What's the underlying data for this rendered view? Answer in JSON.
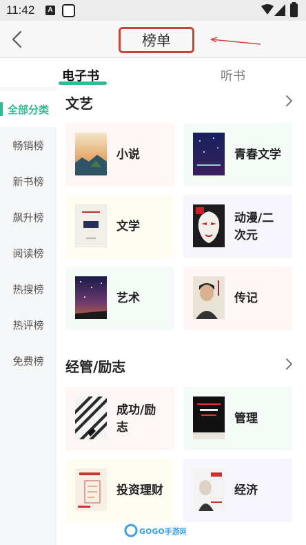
{
  "status_bar": {
    "time": "11:42",
    "notif_letter": "A"
  },
  "header": {
    "title": "榜单"
  },
  "tabs": [
    {
      "label": "电子书"
    },
    {
      "label": "听书"
    }
  ],
  "sidebar": {
    "items": [
      {
        "label": "全部分类"
      },
      {
        "label": "畅销榜"
      },
      {
        "label": "新书榜"
      },
      {
        "label": "飙升榜"
      },
      {
        "label": "阅读榜"
      },
      {
        "label": "热搜榜"
      },
      {
        "label": "热评榜"
      },
      {
        "label": "免费榜"
      }
    ]
  },
  "sections": [
    {
      "title": "文艺",
      "cards": [
        {
          "label": "小说",
          "cover_icon": "book-cover-landscape"
        },
        {
          "label": "青春文学",
          "cover_icon": "book-cover-night-sky"
        },
        {
          "label": "文学",
          "cover_icon": "book-cover-plain"
        },
        {
          "label": "动漫/二次元",
          "label_line1": "动漫/二",
          "label_line2": "次元",
          "cover_icon": "book-cover-mask"
        },
        {
          "label": "艺术",
          "cover_icon": "book-cover-starry-sky"
        },
        {
          "label": "传记",
          "cover_icon": "book-cover-portrait"
        }
      ]
    },
    {
      "title": "经管/励志",
      "cards": [
        {
          "label": "成功/励志",
          "label_line1": "成功/励",
          "label_line2": "志",
          "cover_icon": "book-cover-stripes"
        },
        {
          "label": "管理",
          "cover_icon": "book-cover-principles"
        },
        {
          "label": "投资理财",
          "cover_icon": "book-cover-finance"
        },
        {
          "label": "经济",
          "cover_icon": "book-cover-economics"
        }
      ]
    }
  ],
  "watermark": {
    "text": "GOGO手游网"
  },
  "colors": {
    "accent": "#2ebc96",
    "highlight_box": "#c9443b"
  }
}
